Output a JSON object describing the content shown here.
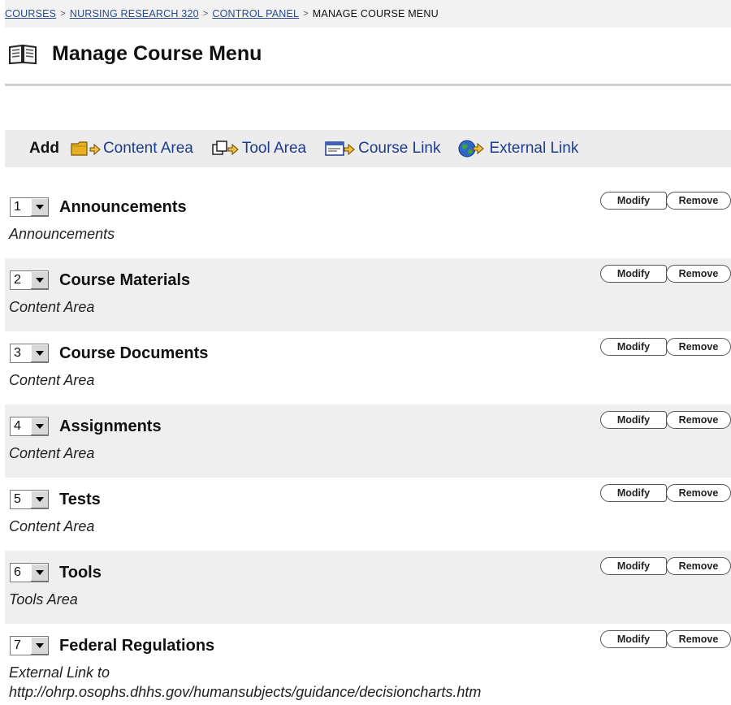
{
  "breadcrumb": {
    "items": [
      "COURSES",
      "NURSING RESEARCH 320",
      "CONTROL PANEL"
    ],
    "separator": ">",
    "current": "MANAGE COURSE MENU"
  },
  "page": {
    "title": "Manage Course Menu",
    "icon": "book-icon"
  },
  "add_bar": {
    "label": "Add",
    "items": [
      {
        "label": "Content Area",
        "icon": "folder-add-icon"
      },
      {
        "label": "Tool Area",
        "icon": "tool-add-icon"
      },
      {
        "label": "Course Link",
        "icon": "course-link-add-icon"
      },
      {
        "label": "External Link",
        "icon": "globe-add-icon"
      }
    ]
  },
  "buttons": {
    "modify": "Modify",
    "remove": "Remove"
  },
  "menu_items": [
    {
      "order": "1",
      "name": "Announcements",
      "type": "Announcements"
    },
    {
      "order": "2",
      "name": "Course Materials",
      "type": "Content Area"
    },
    {
      "order": "3",
      "name": "Course Documents",
      "type": "Content Area"
    },
    {
      "order": "4",
      "name": "Assignments",
      "type": "Content Area"
    },
    {
      "order": "5",
      "name": "Tests",
      "type": "Content Area"
    },
    {
      "order": "6",
      "name": "Tools",
      "type": "Tools Area"
    },
    {
      "order": "7",
      "name": "Federal Regulations",
      "type": "External Link to",
      "type_line2": "http://ohrp.osophs.dhhs.gov/humansubjects/guidance/decisioncharts.htm"
    }
  ]
}
